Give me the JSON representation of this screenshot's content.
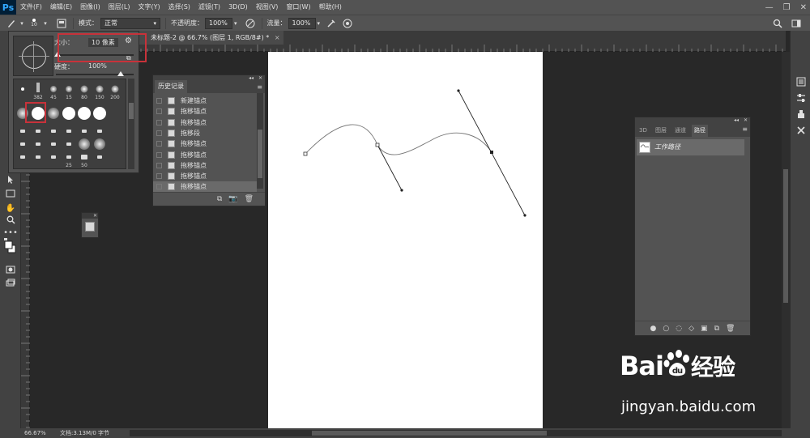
{
  "app": {
    "logo": "Ps"
  },
  "menu": {
    "items": [
      "文件(F)",
      "编辑(E)",
      "图像(I)",
      "图层(L)",
      "文字(Y)",
      "选择(S)",
      "滤镜(T)",
      "3D(D)",
      "视图(V)",
      "窗口(W)",
      "帮助(H)"
    ]
  },
  "window_controls": {
    "minimize": "—",
    "maximize": "❐",
    "close": "✕"
  },
  "options": {
    "brush_size": "10",
    "mode_label": "模式：",
    "mode_value": "正常",
    "opacity_label": "不透明度：",
    "opacity_value": "100%",
    "flow_label": "流量：",
    "flow_value": "100%"
  },
  "document_tab": {
    "title": "未标题-2 @ 66.7% (图层 1, RGB/8#) *",
    "close": "×"
  },
  "brush_picker": {
    "size_label": "大小：",
    "size_value": "10 像素",
    "hardness_label": "硬度：",
    "hardness_value": "100%",
    "size_fraction": 0.02,
    "hardness_fraction": 1.0,
    "row1_numbers": [
      "",
      "382",
      "45",
      "15",
      "80",
      "150",
      "200"
    ],
    "last_row_numbers": [
      "",
      "",
      "",
      "25",
      "50",
      "",
      ""
    ]
  },
  "history": {
    "tab_label": "历史记录",
    "items": [
      "新建锚点",
      "拖移锚点",
      "拖移锚点",
      "拖移段",
      "拖移锚点",
      "拖移锚点",
      "拖移锚点",
      "拖移锚点",
      "拖移锚点"
    ],
    "active_index": 8
  },
  "paths_panel": {
    "tabs": [
      "3D",
      "图层",
      "通道",
      "路径"
    ],
    "active_tab": 3,
    "path_name": "工作路径"
  },
  "status": {
    "zoom": "66.67%",
    "doc_info": "文档:3.13M/0 字节"
  },
  "watermark": {
    "brand": "Bai",
    "brand_suffix": "经验",
    "url": "jingyan.baidu.com"
  },
  "colors": {
    "highlight": "#c8323a",
    "panel": "#535353",
    "workspace": "#282828",
    "canvas": "#ffffff"
  }
}
